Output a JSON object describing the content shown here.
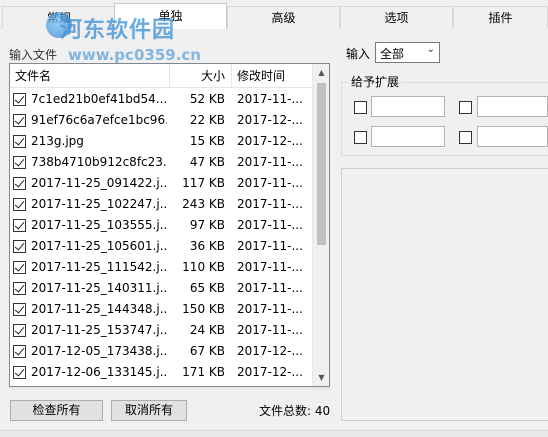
{
  "tabs": [
    {
      "label": "常规"
    },
    {
      "label": "单独"
    },
    {
      "label": "高级"
    },
    {
      "label": "选项"
    },
    {
      "label": "插件"
    }
  ],
  "watermark": {
    "title": "河东软件园",
    "url": "www.pc0359.cn"
  },
  "left": {
    "input_files_label": "输入文件",
    "columns": {
      "name": "文件名",
      "size": "大小",
      "date": "修改时间"
    },
    "files": [
      {
        "name": "7c1ed21b0ef41bd54...",
        "size": "52 KB",
        "date": "2017-11-..."
      },
      {
        "name": "91ef76c6a7efce1bc96...",
        "size": "22 KB",
        "date": "2017-12-..."
      },
      {
        "name": "213g.jpg",
        "size": "15 KB",
        "date": "2017-12-..."
      },
      {
        "name": "738b4710b912c8fc23...",
        "size": "47 KB",
        "date": "2017-11-..."
      },
      {
        "name": "2017-11-25_091422.j...",
        "size": "117 KB",
        "date": "2017-11-..."
      },
      {
        "name": "2017-11-25_102247.j...",
        "size": "243 KB",
        "date": "2017-11-..."
      },
      {
        "name": "2017-11-25_103555.j...",
        "size": "97 KB",
        "date": "2017-11-..."
      },
      {
        "name": "2017-11-25_105601.j...",
        "size": "36 KB",
        "date": "2017-11-..."
      },
      {
        "name": "2017-11-25_111542.j...",
        "size": "110 KB",
        "date": "2017-11-..."
      },
      {
        "name": "2017-11-25_140311.j...",
        "size": "65 KB",
        "date": "2017-11-..."
      },
      {
        "name": "2017-11-25_144348.j...",
        "size": "150 KB",
        "date": "2017-11-..."
      },
      {
        "name": "2017-11-25_153747.j...",
        "size": "24 KB",
        "date": "2017-11-..."
      },
      {
        "name": "2017-12-05_173438.j...",
        "size": "67 KB",
        "date": "2017-12-..."
      },
      {
        "name": "2017-12-06_133145.j...",
        "size": "171 KB",
        "date": "2017-12-..."
      }
    ],
    "check_all_label": "检查所有",
    "uncheck_all_label": "取消所有",
    "total_label": "文件总数: 40"
  },
  "right": {
    "input_label": "输入",
    "input_select_value": "全部",
    "ext_group_title": "给予扩展"
  }
}
